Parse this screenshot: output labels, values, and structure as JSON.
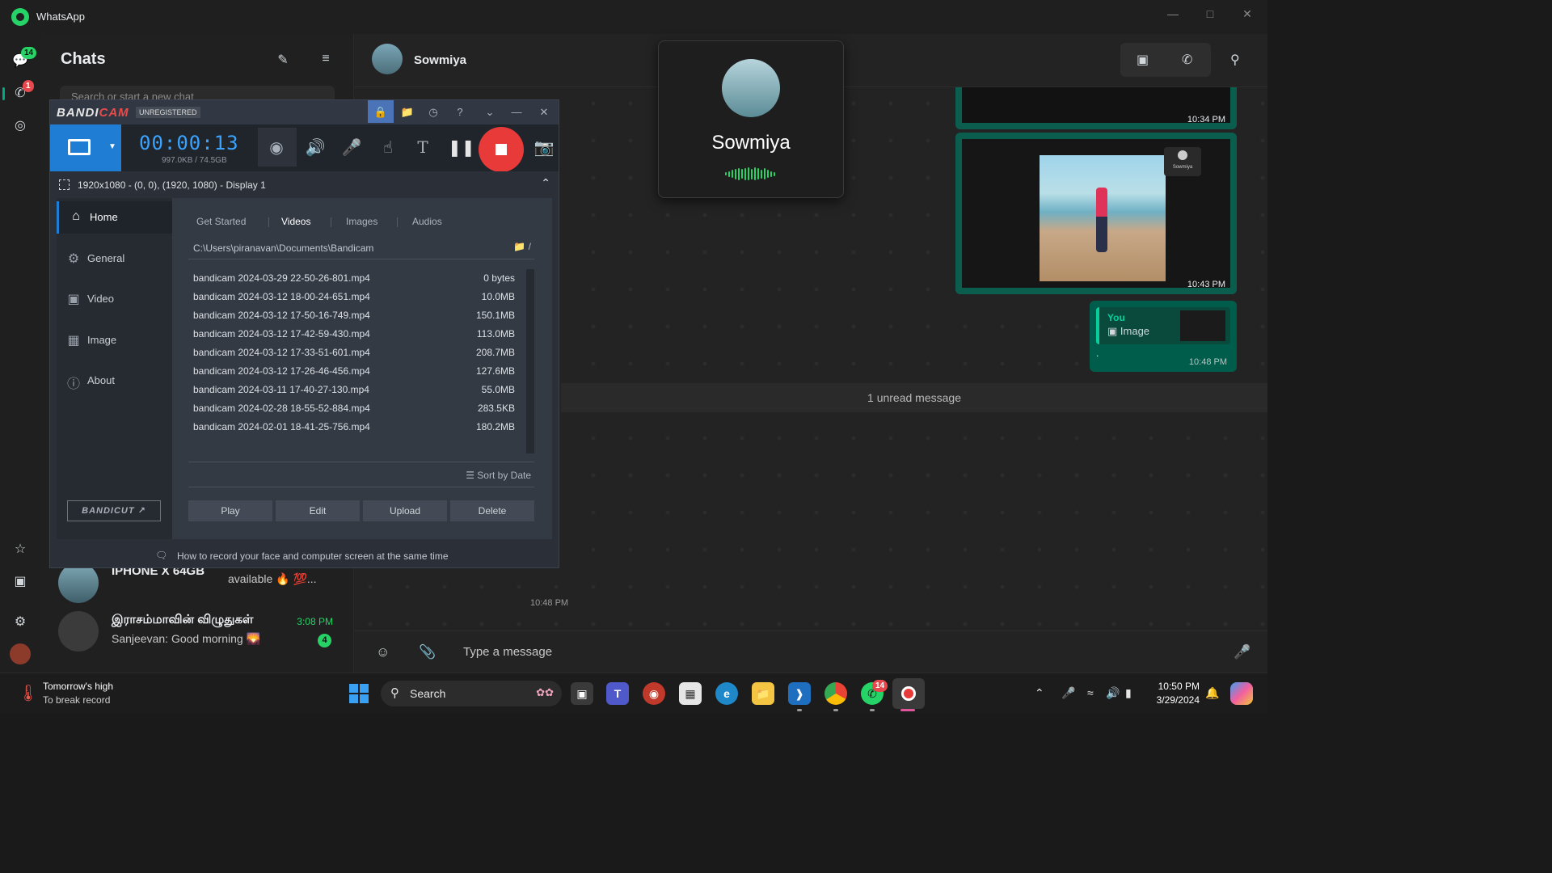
{
  "whatsapp": {
    "title": "WhatsApp",
    "rail": {
      "chats_badge": "14",
      "calls_badge": "1"
    },
    "chatlist": {
      "heading": "Chats",
      "search_placeholder": "Search or start a new chat",
      "items": [
        {
          "name": "IPHONE X 64GB",
          "preview": "available 🔥 💯...",
          "time": "",
          "unread": ""
        },
        {
          "name": "இராசம்மாவின் விழுதுகள்",
          "preview": "Sanjeevan: Good morning 🌄",
          "time": "3:08 PM",
          "unread": "4"
        }
      ]
    },
    "conversation": {
      "contact_name": "Sowmiya",
      "messages": [
        {
          "type": "image",
          "time": "10:34 PM"
        },
        {
          "type": "image",
          "time": "10:43 PM",
          "thumb_label": "Sowmiya"
        },
        {
          "type": "reply",
          "quote_author": "You",
          "quote_text": "Image",
          "body": ".",
          "time": "10:48 PM"
        }
      ],
      "unread_divider": "1 unread message",
      "stray_time": "10:48 PM",
      "composer_placeholder": "Type a message"
    },
    "call_popup": {
      "name": "Sowmiya"
    }
  },
  "bandicam": {
    "brand_bandi": "BANDI",
    "brand_cam": "CAM",
    "registration": "UNREGISTERED",
    "timer": "00:00:13",
    "file_size": "997.0KB / 74.5GB",
    "region": "1920x1080 - (0, 0), (1920, 1080) - Display 1",
    "sidebar": [
      {
        "label": "Home",
        "icon": "home-icon"
      },
      {
        "label": "General",
        "icon": "gear-icon"
      },
      {
        "label": "Video",
        "icon": "video-settings-icon"
      },
      {
        "label": "Image",
        "icon": "image-settings-icon"
      },
      {
        "label": "About",
        "icon": "info-icon"
      }
    ],
    "bandicut_label": "BANDICUT",
    "tabs": [
      "Get Started",
      "Videos",
      "Images",
      "Audios"
    ],
    "active_tab": "Videos",
    "path": "C:\\Users\\piranavan\\Documents\\Bandicam",
    "path_suffix": "/",
    "files": [
      {
        "name": "bandicam 2024-03-29 22-50-26-801.mp4",
        "size": "0 bytes"
      },
      {
        "name": "bandicam 2024-03-12 18-00-24-651.mp4",
        "size": "10.0MB"
      },
      {
        "name": "bandicam 2024-03-12 17-50-16-749.mp4",
        "size": "150.1MB"
      },
      {
        "name": "bandicam 2024-03-12 17-42-59-430.mp4",
        "size": "113.0MB"
      },
      {
        "name": "bandicam 2024-03-12 17-33-51-601.mp4",
        "size": "208.7MB"
      },
      {
        "name": "bandicam 2024-03-12 17-26-46-456.mp4",
        "size": "127.6MB"
      },
      {
        "name": "bandicam 2024-03-11 17-40-27-130.mp4",
        "size": "55.0MB"
      },
      {
        "name": "bandicam 2024-02-28 18-55-52-884.mp4",
        "size": "283.5KB"
      },
      {
        "name": "bandicam 2024-02-01 18-41-25-756.mp4",
        "size": "180.2MB"
      }
    ],
    "sort_label": "Sort by Date",
    "actions": [
      "Play",
      "Edit",
      "Upload",
      "Delete"
    ],
    "tip": "How to record your face and computer screen at the same time"
  },
  "taskbar": {
    "weather_line1": "Tomorrow's high",
    "weather_line2": "To break record",
    "search_label": "Search",
    "whatsapp_badge": "14",
    "time": "10:50 PM",
    "date": "3/29/2024"
  },
  "colors": {
    "whatsapp_green": "#25d366",
    "bandicam_blue": "#1f7ed4",
    "record_red": "#e93a3a"
  }
}
